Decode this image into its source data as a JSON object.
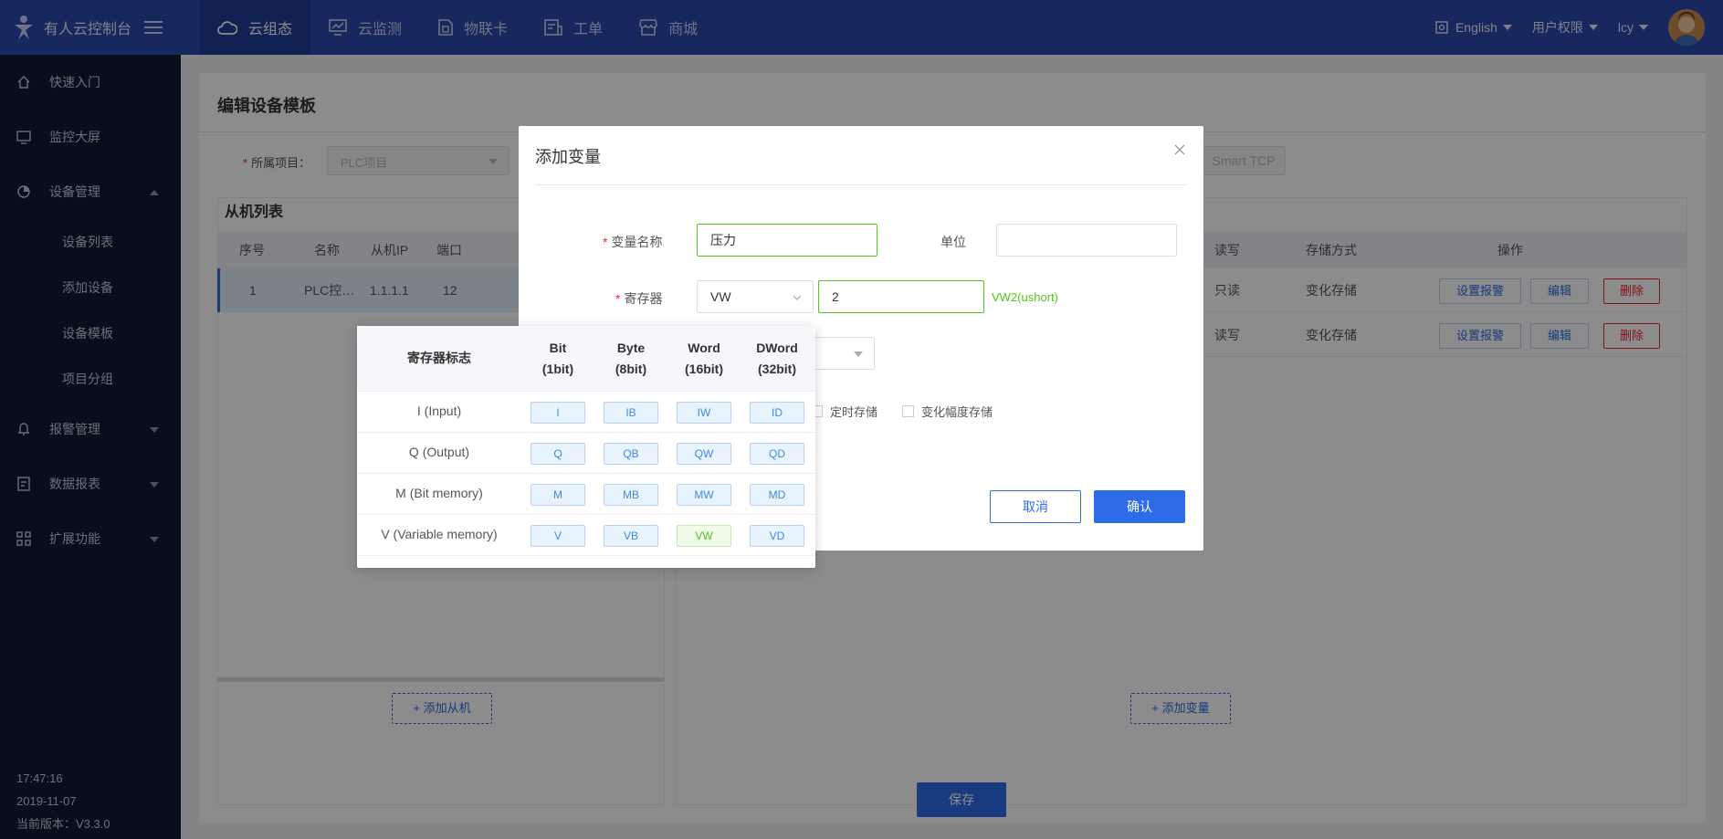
{
  "app": {
    "title": "有人云控制台"
  },
  "nav": [
    "云组态",
    "云监测",
    "物联卡",
    "工单",
    "商城"
  ],
  "topright": {
    "language": "English",
    "permissions": "用户权限",
    "user": "lcy"
  },
  "sidebar": {
    "items": [
      "快速入门",
      "监控大屏",
      "设备管理"
    ],
    "sub": [
      "设备列表",
      "添加设备",
      "设备模板",
      "项目分组"
    ],
    "more": [
      "报警管理",
      "数据报表",
      "扩展功能"
    ],
    "time": "17:47:16",
    "date": "2019-11-07",
    "version": "当前版本：V3.3.0"
  },
  "page": {
    "title": "编辑设备模板",
    "project_label": "所属项目：",
    "project_value": "PLC项目",
    "protocol": "Smart TCP",
    "slave_title": "从机列表",
    "slave_headers": [
      "序号",
      "名称",
      "从机IP",
      "端口"
    ],
    "slave_row": [
      "1",
      "PLC控…",
      "1.1.1.1",
      "12"
    ],
    "var_headers": [
      "读写",
      "存储方式",
      "操作"
    ],
    "var_rows": [
      {
        "rw": "只读",
        "store": "变化存储"
      },
      {
        "rw": "读写",
        "store": "变化存储"
      }
    ],
    "btn_alarm": "设置报警",
    "btn_edit": "编辑",
    "btn_delete": "删除",
    "add_slave": "+ 添加从机",
    "add_var": "+ 添加变量",
    "save": "保存"
  },
  "modal": {
    "title": "添加变量",
    "name_label": "变量名称",
    "name_value": "压力",
    "unit_label": "单位",
    "unit_value": "",
    "reg_label": "寄存器",
    "reg_type": "VW",
    "reg_addr": "2",
    "reg_hint": "VW2(ushort)",
    "store_timed": "定时存储",
    "store_delta": "变化幅度存储",
    "cancel": "取消",
    "confirm": "确认"
  },
  "popover": {
    "headers": [
      "寄存器标志",
      "Bit\n(1bit)",
      "Byte\n(8bit)",
      "Word\n(16bit)",
      "DWord\n(32bit)"
    ],
    "rows": [
      {
        "label": "I (Input)",
        "tags": [
          "I",
          "IB",
          "IW",
          "ID"
        ]
      },
      {
        "label": "Q (Output)",
        "tags": [
          "Q",
          "QB",
          "QW",
          "QD"
        ]
      },
      {
        "label": "M (Bit memory)",
        "tags": [
          "M",
          "MB",
          "MW",
          "MD"
        ]
      },
      {
        "label": "V (Variable memory)",
        "tags": [
          "V",
          "VB",
          "VW",
          "VD"
        ]
      }
    ],
    "selected": "VW"
  },
  "colors": {
    "topbar": "#2b4aab",
    "sidebar": "#0d1b36",
    "primary": "#2e6be6",
    "success": "#52c41a",
    "danger": "#f5222d"
  }
}
